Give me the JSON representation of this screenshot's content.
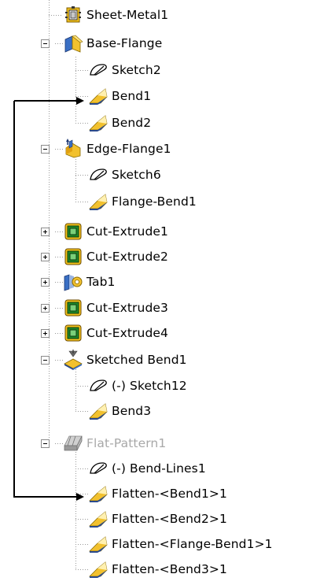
{
  "tree": {
    "items": [
      {
        "label": "Sheet-Metal1",
        "icon": "sheet-metal-icon",
        "expandable": false
      },
      {
        "label": "Base-Flange",
        "icon": "base-flange-icon",
        "expandable": true,
        "expanded": true
      },
      {
        "label": "Sketch2",
        "icon": "sketch-icon",
        "expandable": false
      },
      {
        "label": "Bend1",
        "icon": "bend-icon",
        "expandable": false
      },
      {
        "label": "Bend2",
        "icon": "bend-icon",
        "expandable": false
      },
      {
        "label": "Edge-Flange1",
        "icon": "edge-flange-icon",
        "expandable": true,
        "expanded": true
      },
      {
        "label": "Sketch6",
        "icon": "sketch-icon",
        "expandable": false
      },
      {
        "label": "Flange-Bend1",
        "icon": "bend-icon",
        "expandable": false
      },
      {
        "label": "Cut-Extrude1",
        "icon": "cut-extrude-icon",
        "expandable": true,
        "expanded": false
      },
      {
        "label": "Cut-Extrude2",
        "icon": "cut-extrude-icon",
        "expandable": true,
        "expanded": false
      },
      {
        "label": "Tab1",
        "icon": "tab-icon",
        "expandable": true,
        "expanded": false
      },
      {
        "label": "Cut-Extrude3",
        "icon": "cut-extrude-icon",
        "expandable": true,
        "expanded": false
      },
      {
        "label": "Cut-Extrude4",
        "icon": "cut-extrude-icon",
        "expandable": true,
        "expanded": false
      },
      {
        "label": "Sketched Bend1",
        "icon": "sketched-bend-icon",
        "expandable": true,
        "expanded": true
      },
      {
        "label": "(-) Sketch12",
        "icon": "sketch-icon",
        "expandable": false
      },
      {
        "label": "Bend3",
        "icon": "bend-icon",
        "expandable": false
      },
      {
        "label": "Flat-Pattern1",
        "icon": "flat-pattern-icon",
        "expandable": true,
        "expanded": true,
        "suppressed": true
      },
      {
        "label": "(-) Bend-Lines1",
        "icon": "sketch-icon",
        "expandable": false
      },
      {
        "label": "Flatten-<Bend1>1",
        "icon": "bend-icon",
        "expandable": false
      },
      {
        "label": "Flatten-<Bend2>1",
        "icon": "bend-icon",
        "expandable": false
      },
      {
        "label": "Flatten-<Flange-Bend1>1",
        "icon": "bend-icon",
        "expandable": false
      },
      {
        "label": "Flatten-<Bend3>1",
        "icon": "bend-icon",
        "expandable": false
      }
    ]
  },
  "colors": {
    "arrow": "#000000",
    "dotted_line": "#9a9a9a",
    "suppressed_text": "#a8a8a8",
    "bend_yellow": "#f2c12e",
    "bend_blue": "#2a4a8c",
    "cut_extrude_yellow": "#f4c21a",
    "cut_extrude_green": "#1f8a2a"
  },
  "annotation": {
    "type": "arrow",
    "from": "Bend1",
    "to": "Flatten-<Bend1>1"
  }
}
